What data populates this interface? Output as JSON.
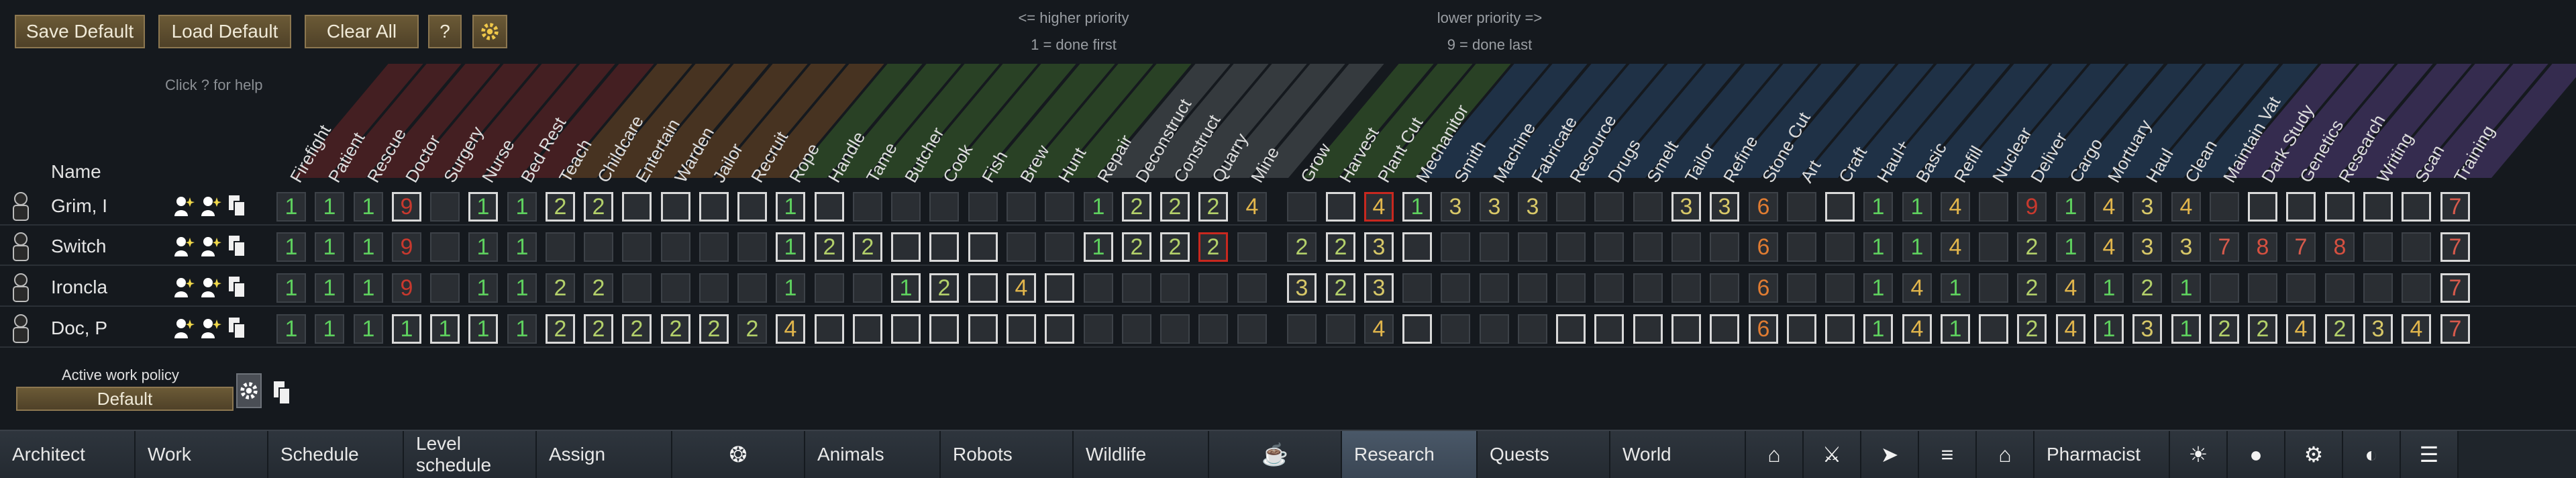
{
  "toolbar": {
    "save_default": "Save Default",
    "load_default": "Load Default",
    "clear_all": "Clear All",
    "help": "?",
    "help_hint": "Click ? for help"
  },
  "priority_hints": {
    "higher": "<= higher priority",
    "first": "1 = done first",
    "lower": "lower priority =>",
    "last": "9 = done last"
  },
  "name_header": "Name",
  "columns": [
    "Firefight",
    "Patient",
    "Rescue",
    "Doctor",
    "Surgery",
    "Nurse",
    "Bed Rest",
    "Teach",
    "Childcare",
    "Entertain",
    "Warden",
    "Jailor",
    "Recruit",
    "Rope",
    "Handle",
    "Tame",
    "Butcher",
    "Cook",
    "Fish",
    "Brew",
    "Hunt",
    "Repair",
    "Deconstruct",
    "Construct",
    "Quarry",
    "Mine",
    "Grow",
    "Harvest",
    "Plant Cut",
    "Mechanitor",
    "Smith",
    "Machine",
    "Fabricate",
    "Resource",
    "Drugs",
    "Smelt",
    "Tailor",
    "Refine",
    "Stone Cut",
    "Art",
    "Craft",
    "Haul+",
    "Basic",
    "Refill",
    "Nuclear",
    "Deliver",
    "Cargo",
    "Mortuary",
    "Haul",
    "Clean",
    "Maintain Vat",
    "Dark Study",
    "Genetics",
    "Research",
    "Writing",
    "Scan",
    "Training"
  ],
  "pawns": [
    {
      "name": "Grim, I",
      "cells": [
        "1",
        "1",
        "1",
        "9",
        "",
        "1",
        "1",
        "2",
        "2",
        "",
        "",
        "",
        "",
        "1",
        "",
        "",
        "",
        "",
        "",
        "",
        "",
        "1",
        "2",
        "2",
        "2",
        "4",
        "",
        "",
        "4",
        "1",
        "3",
        "3",
        "3",
        "",
        "",
        "",
        "3",
        "3",
        "6",
        "",
        "",
        "1",
        "1",
        "4",
        "",
        "9",
        "1",
        "4",
        "3",
        "4",
        "",
        "",
        "",
        "",
        "",
        "",
        "7"
      ]
    },
    {
      "name": "Switch",
      "cells": [
        "1",
        "1",
        "1",
        "9",
        "",
        "1",
        "1",
        "",
        "",
        "",
        "",
        "",
        "",
        "1",
        "2",
        "2",
        "",
        "",
        "",
        "",
        "",
        "1",
        "2",
        "2",
        "2",
        "",
        "2",
        "2",
        "3",
        "",
        "",
        "",
        "",
        "",
        "",
        "",
        "",
        "",
        "6",
        "",
        "",
        "1",
        "1",
        "4",
        "",
        "2",
        "1",
        "4",
        "3",
        "3",
        "7",
        "8",
        "7",
        "8",
        "",
        "",
        "7"
      ]
    },
    {
      "name": "Ironcla",
      "cells": [
        "1",
        "1",
        "1",
        "9",
        "",
        "1",
        "1",
        "2",
        "2",
        "",
        "",
        "",
        "",
        "1",
        "",
        "",
        "1",
        "2",
        "",
        "4",
        "",
        "",
        "",
        "",
        "",
        "",
        "3",
        "2",
        "3",
        "",
        "",
        "",
        "",
        "",
        "",
        "",
        "",
        "",
        "6",
        "",
        "",
        "1",
        "4",
        "1",
        "",
        "2",
        "4",
        "1",
        "2",
        "1",
        "",
        "",
        "",
        "",
        "",
        "",
        "7"
      ]
    },
    {
      "name": "Doc, P",
      "cells": [
        "1",
        "1",
        "1",
        "1",
        "1",
        "1",
        "1",
        "2",
        "2",
        "2",
        "2",
        "2",
        "2",
        "4",
        "",
        "",
        "",
        "",
        "",
        "",
        "",
        "",
        "",
        "",
        "",
        "",
        "",
        "",
        "4",
        "",
        "",
        "",
        "",
        "",
        "",
        "",
        "",
        "",
        "6",
        "",
        "",
        "1",
        "4",
        "1",
        "",
        "2",
        "4",
        "1",
        "3",
        "1",
        "2",
        "2",
        "4",
        "2",
        "3",
        "4",
        "7"
      ]
    }
  ],
  "policy": {
    "label": "Active work policy",
    "value": "Default"
  },
  "bottom_tabs": [
    "Architect",
    "Work",
    "Schedule",
    "Level schedule",
    "Assign",
    "",
    "Animals",
    "Robots",
    "Wildlife",
    "",
    "Research",
    "Quests",
    "World",
    "",
    "",
    "",
    "",
    "",
    "Pharmacist",
    "",
    "",
    "",
    "",
    ""
  ],
  "active_tab": "Research",
  "group_colors": [
    "#c02d2d",
    "#c9762a",
    "#c9a42a",
    "#5fa83a",
    "#8a8f95",
    "#3a6fb0",
    "#8a5ccf"
  ]
}
